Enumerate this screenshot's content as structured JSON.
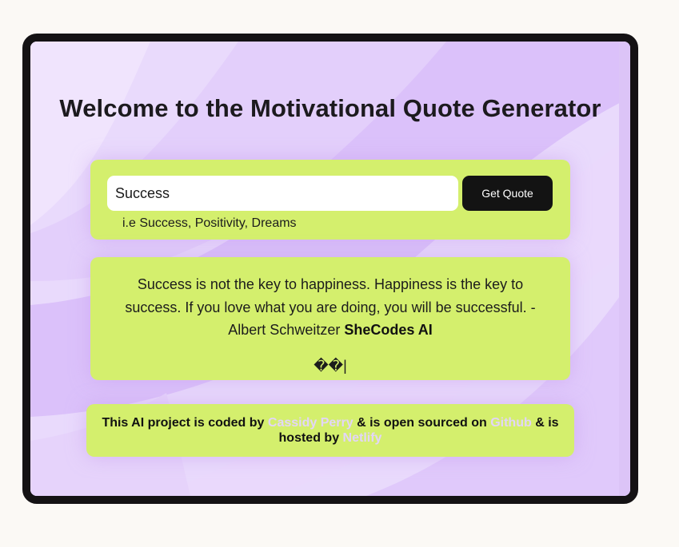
{
  "page": {
    "title": "Welcome to the Motivational Quote Generator"
  },
  "search": {
    "value": "Success",
    "button_label": "Get Quote",
    "hint": "i.e Success, Positivity, Dreams"
  },
  "quote": {
    "text": "Success is not the key to happiness. Happiness is the key to success. If you love what you are doing, you will be successful. - Albert Schweitzer ",
    "signature": "SheCodes AI",
    "cursor": "��|"
  },
  "footer": {
    "part1": "This AI project is coded by ",
    "author_link": "Cassidy Perry",
    "part2": " & is open sourced on ",
    "github_link": "Github",
    "part3": " & is hosted by ",
    "netlify_link": "Netlify"
  },
  "colors": {
    "card_bg": "#d4ef6d",
    "button_bg": "#131313",
    "frame_border": "#141214",
    "background": "#e8d9fb",
    "link": "#e2d5f8"
  }
}
